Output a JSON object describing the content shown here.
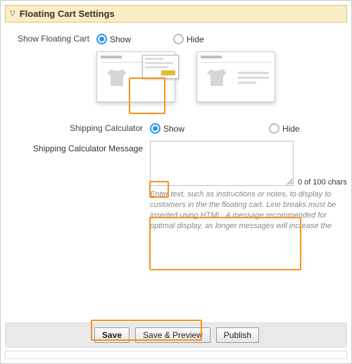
{
  "section": {
    "title": "Floating Cart Settings"
  },
  "floating_cart": {
    "label": "Show Floating Cart",
    "options": {
      "show": "Show",
      "hide": "Hide"
    },
    "selected": "show"
  },
  "shipping_calc": {
    "label": "Shipping Calculator",
    "options": {
      "show": "Show",
      "hide": "Hide"
    },
    "selected": "show"
  },
  "shipping_msg": {
    "label": "Shipping Calculator Message",
    "value": "",
    "counter": "0 of 100 chars",
    "help": "Enter text, such as instructions or notes, to display to customers in the the floating cart. Line breaks must be inserted using HTML. A message recommended for optimal display, as longer messages will increase the"
  },
  "actions": {
    "save": "Save",
    "save_preview": "Save & Preview",
    "publish": "Publish"
  }
}
